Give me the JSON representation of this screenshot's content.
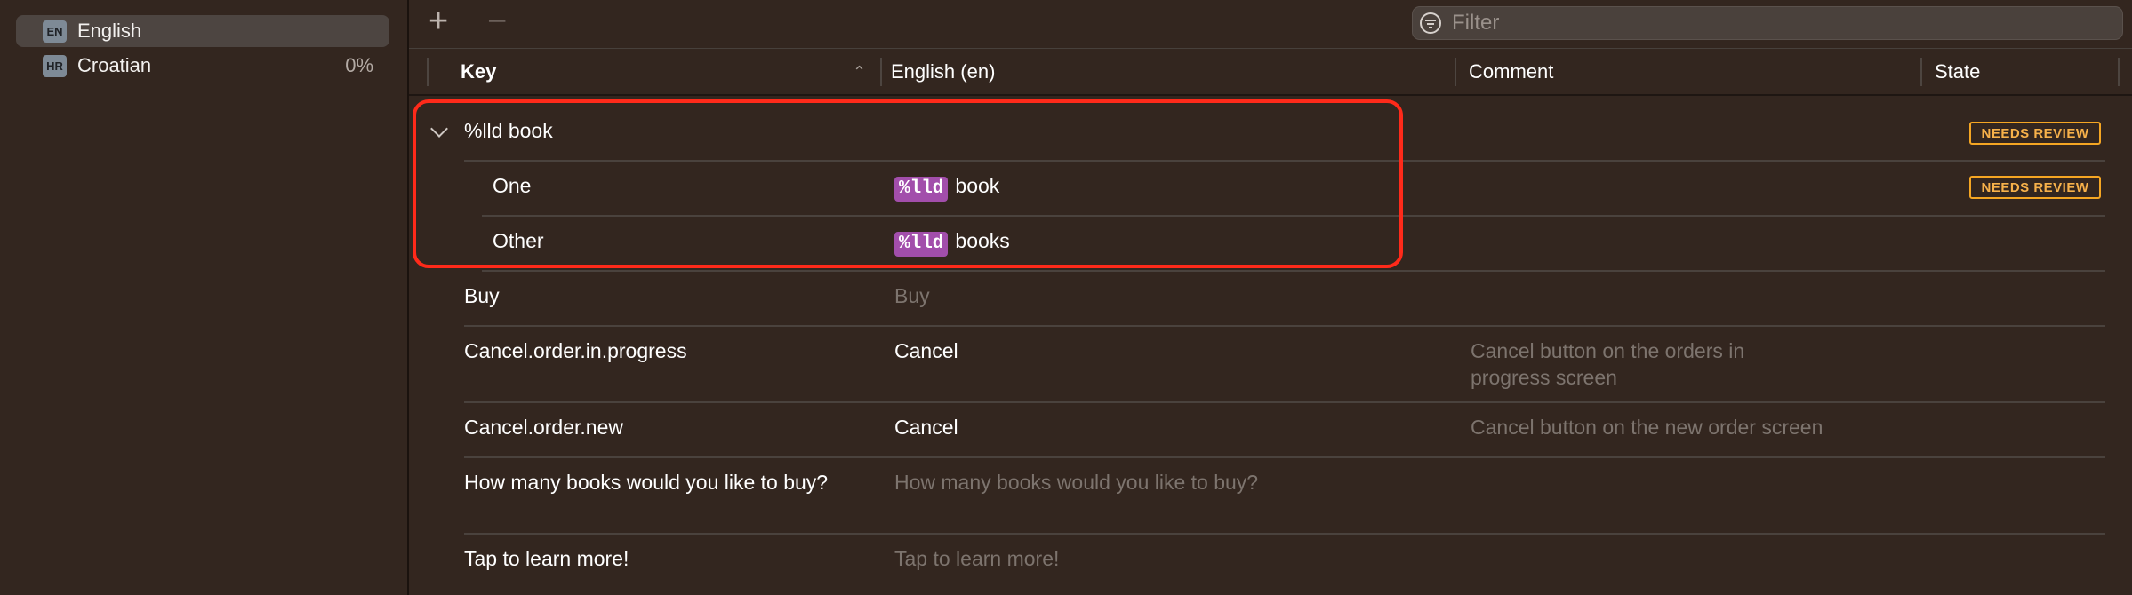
{
  "sidebar": {
    "languages": [
      {
        "code": "EN",
        "name": "English",
        "percent": ""
      },
      {
        "code": "HR",
        "name": "Croatian",
        "percent": "0%"
      }
    ]
  },
  "toolbar": {
    "add_label": "+",
    "remove_label": "−",
    "filter_placeholder": "Filter"
  },
  "columns": [
    "Key",
    "English (en)",
    "Comment",
    "State"
  ],
  "rows": [
    {
      "key": "%lld book",
      "english": "",
      "comment": "",
      "state": "NEEDS REVIEW"
    },
    {
      "key": "One",
      "token": "%lld",
      "english": "book",
      "comment": "",
      "state": "NEEDS REVIEW"
    },
    {
      "key": "Other",
      "token": "%lld",
      "english": "books",
      "comment": "",
      "state": ""
    },
    {
      "key": "Buy",
      "english": "Buy",
      "comment": "",
      "state": ""
    },
    {
      "key": "Cancel.order.in.progress",
      "english": "Cancel",
      "comment": "Cancel button on the orders in progress screen",
      "state": ""
    },
    {
      "key": "Cancel.order.new",
      "english": "Cancel",
      "comment": "Cancel button on the new order screen",
      "state": ""
    },
    {
      "key": "How many books would you like to buy?",
      "english": "How many books would you like to buy?",
      "comment": "",
      "state": ""
    },
    {
      "key": "Tap to learn more!",
      "english": "Tap to learn more!",
      "comment": "",
      "state": ""
    }
  ],
  "colors": {
    "background": "#33261f",
    "selection": "#4d4541",
    "token": "#a24eab",
    "badge": "#f5a623",
    "highlight": "#ff2a1a"
  }
}
